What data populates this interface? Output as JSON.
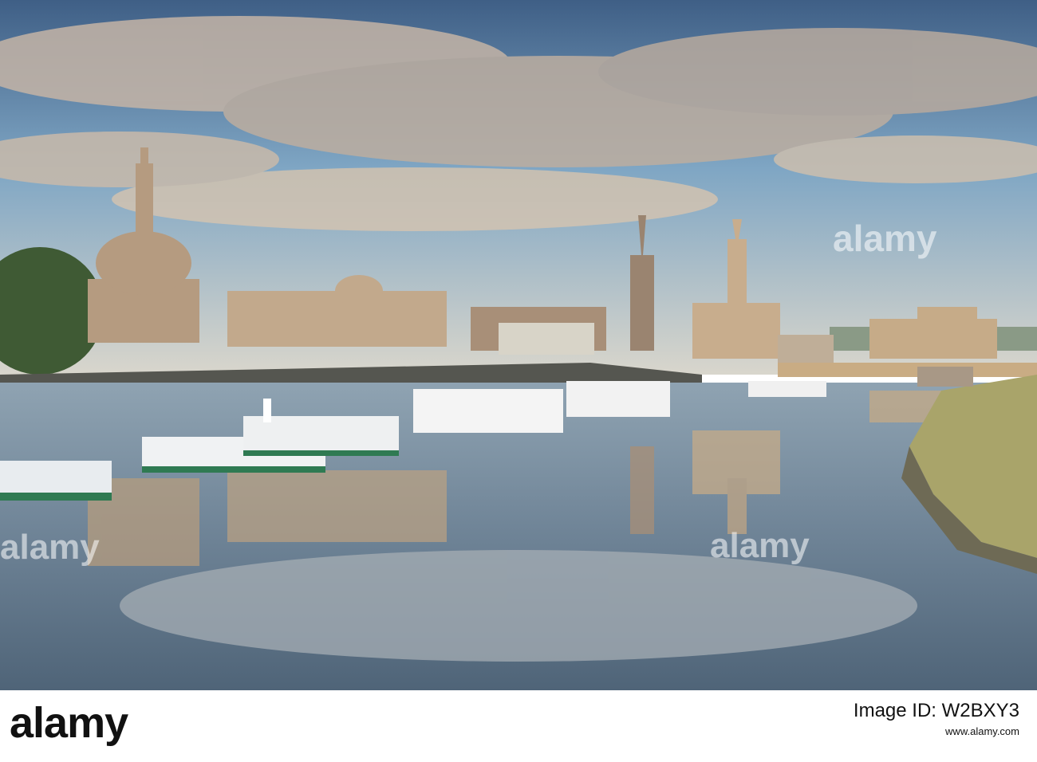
{
  "photo": {
    "subject": "Dresden skyline over the Elbe river with paddle steamers",
    "colors": {
      "sky_top": "#4f6f93",
      "sky_mid": "#8eb0c8",
      "cloud": "#c8b7a6",
      "buildings": "#b8a088",
      "water": "#7d8fa0",
      "embankment": "#5a5a55"
    }
  },
  "watermarks": {
    "top_right": "alamy",
    "middle_left": "alamy",
    "middle_right": "alamy"
  },
  "footer": {
    "logo": "alamy",
    "image_id_label": "Image ID: W2BXY3",
    "url": "www.alamy.com"
  }
}
